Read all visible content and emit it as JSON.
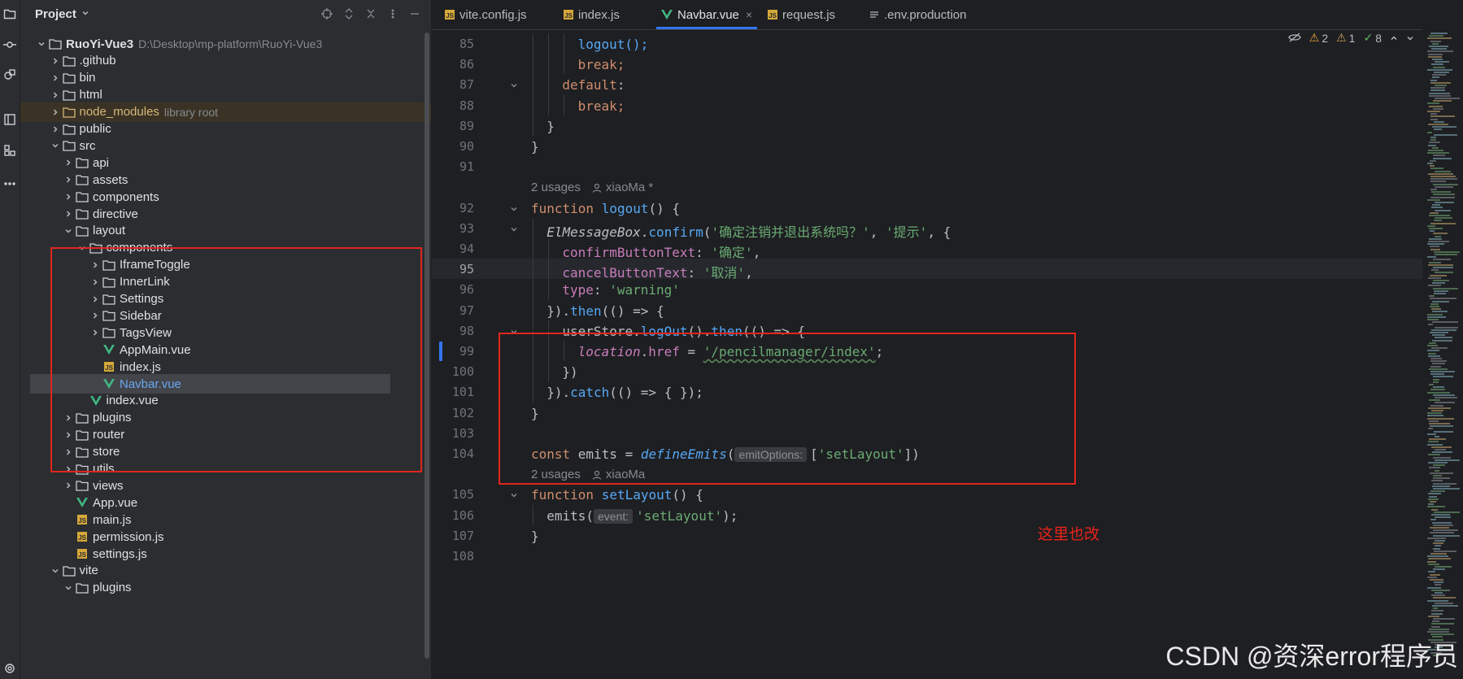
{
  "sidebar_tools": [
    "folder-icon",
    "commit-icon",
    "plugin-icon",
    "structure-icon",
    "modules-icon",
    "more-icon"
  ],
  "project": {
    "title": "Project",
    "root": {
      "name": "RuoYi-Vue3",
      "path": "D:\\Desktop\\mp-platform\\RuoYi-Vue3"
    },
    "items": [
      {
        "label": ".github"
      },
      {
        "label": "bin"
      },
      {
        "label": "html"
      },
      {
        "label": "node_modules",
        "hint": "library root"
      },
      {
        "label": "public"
      },
      {
        "label": "src"
      },
      {
        "label": "api"
      },
      {
        "label": "assets"
      },
      {
        "label": "components"
      },
      {
        "label": "directive"
      },
      {
        "label": "layout"
      },
      {
        "label": "components"
      },
      {
        "label": "IframeToggle"
      },
      {
        "label": "InnerLink"
      },
      {
        "label": "Settings"
      },
      {
        "label": "Sidebar"
      },
      {
        "label": "TagsView"
      },
      {
        "label": "AppMain.vue"
      },
      {
        "label": "index.js"
      },
      {
        "label": "Navbar.vue"
      },
      {
        "label": "index.vue"
      },
      {
        "label": "plugins"
      },
      {
        "label": "router"
      },
      {
        "label": "store"
      },
      {
        "label": "utils"
      },
      {
        "label": "views"
      },
      {
        "label": "App.vue"
      },
      {
        "label": "main.js"
      },
      {
        "label": "permission.js"
      },
      {
        "label": "settings.js"
      },
      {
        "label": "vite"
      },
      {
        "label": "plugins"
      }
    ]
  },
  "tabs": [
    {
      "label": "vite.config.js"
    },
    {
      "label": "index.js"
    },
    {
      "label": "Navbar.vue",
      "close": "×"
    },
    {
      "label": "request.js"
    },
    {
      "label": ".env.production"
    }
  ],
  "inspections": {
    "warnings": "2",
    "weak_warnings": "1",
    "checks": "8"
  },
  "line_numbers": [
    "85",
    "86",
    "87",
    "88",
    "89",
    "90",
    "91",
    "92",
    "93",
    "94",
    "95",
    "96",
    "97",
    "98",
    "99",
    "100",
    "101",
    "102",
    "103",
    "104",
    "105",
    "106",
    "107",
    "108"
  ],
  "code": {
    "l85": "logout();",
    "l86": "break;",
    "l87a": "default",
    "l87b": ":",
    "l88": "break;",
    "l89": "}",
    "l90": "}",
    "u1_count": "2 usages",
    "u1_author": "xiaoMa *",
    "l92a": "function ",
    "l92b": "logout",
    "l92c": "() {",
    "l93a": "ElMessageBox",
    "l93b": ".",
    "l93c": "confirm",
    "l93d": "(",
    "l93e": "'确定注销并退出系统吗？'",
    "l93f": ", ",
    "l93g": "'提示'",
    "l93h": ", {",
    "l94a": "confirmButtonText",
    "l94b": ": ",
    "l94c": "'确定'",
    "l94d": ",",
    "l95a": "cancelButtonText",
    "l95b": ": ",
    "l95c": "'取消'",
    "l95d": ",",
    "l96a": "type",
    "l96b": ": ",
    "l96c": "'warning'",
    "l97a": "}).",
    "l97b": "then",
    "l97c": "(() => {",
    "l98a": "userStore.",
    "l98b": "logOut",
    "l98c": "().",
    "l98d": "then",
    "l98e": "(() => {",
    "l99a": "location",
    "l99b": ".",
    "l99c": "href",
    "l99d": " = ",
    "l99e": "'/pencilmanager/index'",
    "l99f": ";",
    "l100": "})",
    "l101a": "}).",
    "l101b": "catch",
    "l101c": "(() => { });",
    "l102": "}",
    "l104a": "const ",
    "l104b": "emits = ",
    "l104c": "defineEmits",
    "l104d": "(",
    "l104hint": "emitOptions:",
    "l104e": "[",
    "l104f": "'setLayout'",
    "l104g": "])",
    "u2_count": "2 usages",
    "u2_author": "xiaoMa",
    "l105a": "function ",
    "l105b": "setLayout",
    "l105c": "() {",
    "l106a": "emits(",
    "l106hint": "event:",
    "l106b": "'setLayout'",
    "l106c": ");",
    "l107": "}"
  },
  "annotation": "这里也改",
  "watermark": "CSDN @资深error程序员",
  "colors": {
    "highlight": "#e0261d",
    "accent": "#3574f0"
  }
}
